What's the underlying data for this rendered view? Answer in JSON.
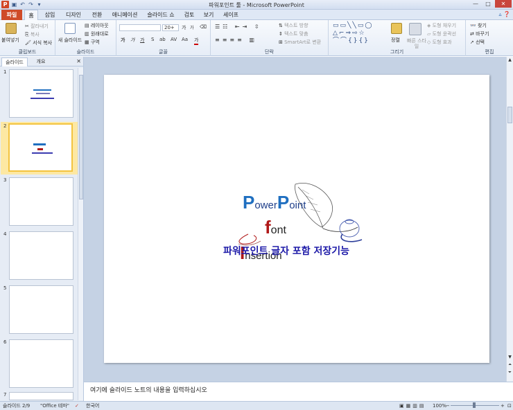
{
  "window": {
    "title": "파워포인트 툴 - Microsoft PowerPoint",
    "app_icon": "P",
    "min": "—",
    "max": "□",
    "close": "✕"
  },
  "qat": [
    "save-icon",
    "undo-icon",
    "redo-icon",
    "customize-icon"
  ],
  "tabs": [
    {
      "label": "파일"
    },
    {
      "label": "홈"
    },
    {
      "label": "삽입"
    },
    {
      "label": "디자인"
    },
    {
      "label": "전환"
    },
    {
      "label": "애니메이션"
    },
    {
      "label": "슬라이드 쇼"
    },
    {
      "label": "검토"
    },
    {
      "label": "보기"
    },
    {
      "label": "세이프"
    }
  ],
  "ribbon": {
    "clipboard": {
      "label": "클립보드",
      "paste": "붙여넣기",
      "cut": "잘라내기",
      "copy": "복사",
      "format_painter": "서식 복사"
    },
    "slides": {
      "label": "슬라이드",
      "new_slide": "새 슬라이드",
      "layout": "레이아웃",
      "reset": "원래대로",
      "section": "구역"
    },
    "font": {
      "label": "글꼴",
      "size": "20+",
      "grow": "가",
      "shrink": "가",
      "bold": "가",
      "italic": "가",
      "underline": "가",
      "strike": "S",
      "shadow": "ab",
      "spacing": "AV",
      "case": "Aa",
      "color": "가"
    },
    "paragraph": {
      "label": "단락",
      "text_direction": "텍스트 방향",
      "align_text": "텍스트 맞춤",
      "smartart": "SmartArt로 변환"
    },
    "drawing": {
      "label": "그리기",
      "arrange": "정렬",
      "quick_styles": "빠른 스타일",
      "fill": "도형 채우기",
      "outline": "도형 윤곽선",
      "effects": "도형 효과"
    },
    "editing": {
      "label": "편집",
      "find": "찾기",
      "replace": "바꾸기",
      "select": "선택"
    }
  },
  "left_panel": {
    "tab_slides": "슬라이드",
    "tab_outline": "개요",
    "close": "✕",
    "slides": [
      {
        "num": "1"
      },
      {
        "num": "2"
      },
      {
        "num": "3"
      },
      {
        "num": "4"
      },
      {
        "num": "5"
      },
      {
        "num": "6"
      },
      {
        "num": "7"
      }
    ]
  },
  "slide": {
    "line1_big1": "P",
    "line1_small1": "ower",
    "line1_big2": "P",
    "line1_small2": "oint",
    "line2_big": "f",
    "line2_small": "ont",
    "line3_big": "I",
    "line3_small": "nsertion",
    "subtitle": "파워포인트 글자 포함 저장기능"
  },
  "notes": {
    "placeholder": "여기에 슬라이드 노트의 내용을 입력하십시오"
  },
  "status": {
    "slide_info": "슬라이드 2/9",
    "theme": "\"Office 테마\"",
    "language": "한국어",
    "zoom": "100%"
  },
  "colors": {
    "file_tab": "#cf4b28",
    "accent_blue": "#1f6fc0",
    "accent_red": "#b01818",
    "subtitle_blue": "#1d1aa8"
  }
}
